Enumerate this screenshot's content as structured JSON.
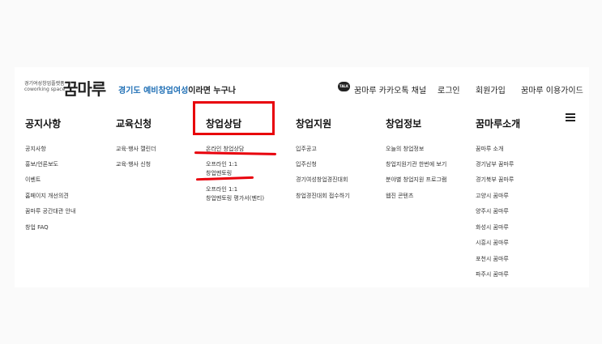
{
  "header": {
    "logo_small_line1": "경기여성창업플랫폼",
    "logo_small_line2": "coworking space",
    "logo_mark": "꿈마루",
    "slogan_highlight": "경기도 예비창업여성",
    "slogan_rest": "이라면 누구나",
    "kakao_icon_text": "TALK",
    "kakao_label": "꿈마루 카카오톡 채널",
    "login": "로그인",
    "signup": "회원가입",
    "guide": "꿈마루 이용가이드"
  },
  "nav": [
    {
      "label": "공지사항",
      "items": [
        "공지사항",
        "홍보/언론보도",
        "이벤트",
        "홈페이지 개선의견",
        "꿈마루 공간대관 안내",
        "창업 FAQ"
      ]
    },
    {
      "label": "교육신청",
      "items": [
        "교육·행사 캘린더",
        "교육·행사 신청"
      ]
    },
    {
      "label": "창업상담",
      "items": [
        "온라인 창업상담",
        "오프라인 1:1",
        "창업멘토링",
        "오프라인 1:1",
        "창업멘토링 평가서(멘티)"
      ]
    },
    {
      "label": "창업지원",
      "items": [
        "입주공고",
        "입주신청",
        "경기여성창업경진대회",
        "창업경진대회 접수하기"
      ]
    },
    {
      "label": "창업정보",
      "items": [
        "오늘의 창업정보",
        "창업지원기관 한번에 보기",
        "분야별 창업지원 프로그램",
        "웹진 콘텐츠"
      ]
    },
    {
      "label": "꿈마루소개",
      "items": [
        "꿈마루 소개",
        "경기남부 꿈마루",
        "경기북부 꿈마루",
        "고양시 꿈마루",
        "양주시 꿈마루",
        "화성시 꿈마루",
        "시흥시 꿈마루",
        "포천시 꿈마루",
        "파주시 꿈마루"
      ]
    }
  ],
  "colors": {
    "accent_blue": "#1f6fb5",
    "annotation_red": "#e8000b"
  }
}
